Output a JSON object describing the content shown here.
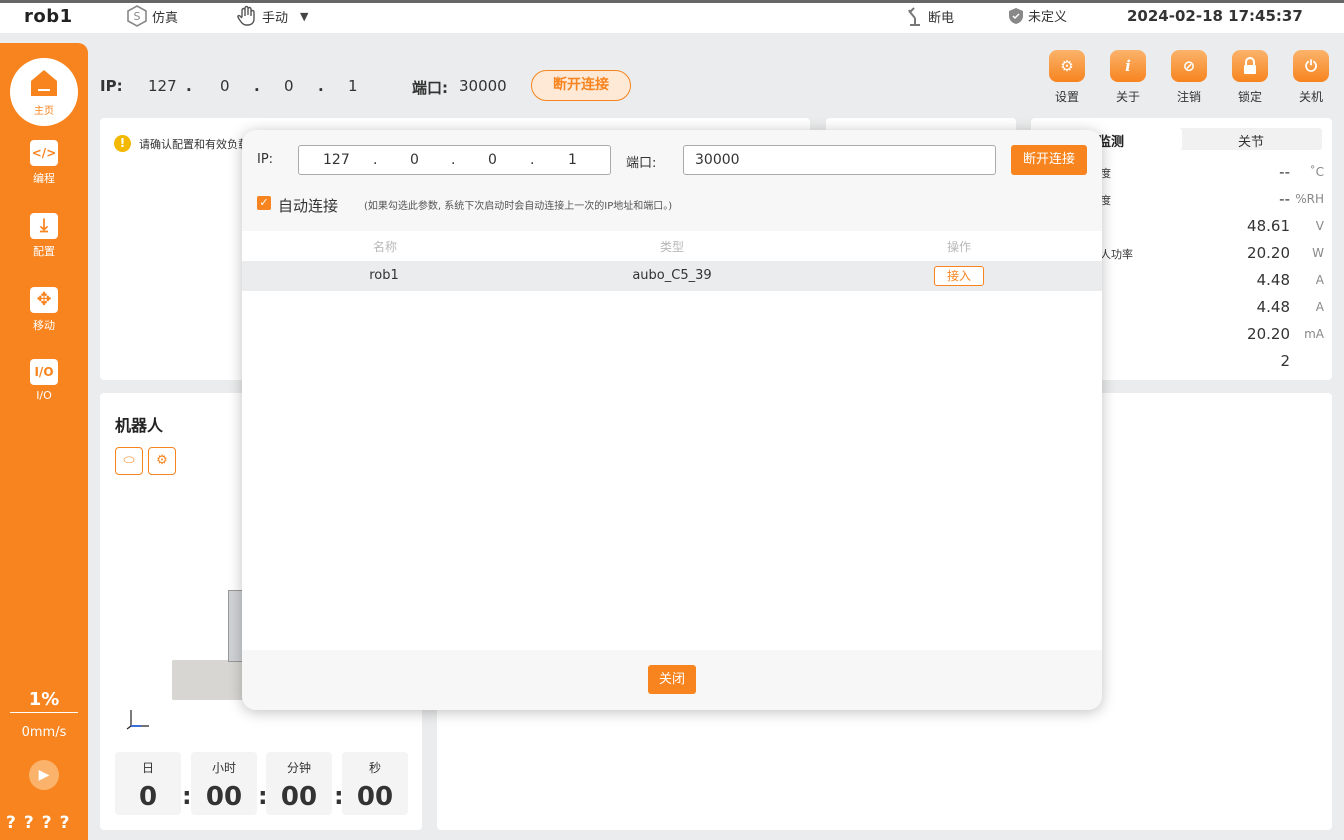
{
  "topbar": {
    "robot_name": "rob1",
    "sim_label": "仿真",
    "mode_label": "手动",
    "power_label": "断电",
    "safety_label": "未定义",
    "datetime": "2024-02-18 17:45:37"
  },
  "sidebar": {
    "home_label": "主页",
    "items": [
      {
        "label": "编程",
        "glyph": "</>"
      },
      {
        "label": "配置",
        "glyph": "⤓"
      },
      {
        "label": "移动",
        "glyph": "✥"
      },
      {
        "label": "I/O",
        "glyph": "I/O"
      }
    ],
    "speed_percent": "1%",
    "speed_mm": "0mm/s",
    "question_marks": "????"
  },
  "connection": {
    "ip_label": "IP:",
    "ip": [
      "127",
      ".",
      "0",
      ".",
      "0",
      ".",
      "1"
    ],
    "port_label": "端口:",
    "port": "30000",
    "disconnect_label": "断开连接"
  },
  "toolbar": [
    {
      "label": "设置",
      "icon": "gear-icon",
      "glyph": "⚙"
    },
    {
      "label": "关于",
      "icon": "info-icon",
      "glyph": "i"
    },
    {
      "label": "注销",
      "icon": "logout-icon",
      "glyph": "⊘"
    },
    {
      "label": "锁定",
      "icon": "lock-icon",
      "glyph": "🔒"
    },
    {
      "label": "关机",
      "icon": "power-icon",
      "glyph": "⏻"
    }
  ],
  "warning": {
    "text": "请确认配置和有效负载"
  },
  "monitor": {
    "tab_a": "监测",
    "tab_b": "关节",
    "rows": [
      {
        "label": "度",
        "value": "--",
        "unit": "˚C"
      },
      {
        "label": "度",
        "value": "--",
        "unit": "%RH"
      },
      {
        "label": "",
        "value": "48.61",
        "unit": "V"
      },
      {
        "label": "人功率",
        "value": "20.20",
        "unit": "W"
      },
      {
        "label": "",
        "value": "4.48",
        "unit": "A"
      },
      {
        "label": "",
        "value": "4.48",
        "unit": "A"
      },
      {
        "label": "",
        "value": "20.20",
        "unit": "mA"
      },
      {
        "label": "",
        "value": "2",
        "unit": ""
      }
    ]
  },
  "robot_panel": {
    "title": "机器人",
    "timer": [
      {
        "label": "日",
        "value": "0"
      },
      {
        "label": "小时",
        "value": "00"
      },
      {
        "label": "分钟",
        "value": "00"
      },
      {
        "label": "秒",
        "value": "00"
      }
    ],
    "colon": ":"
  },
  "modal": {
    "ip_label": "IP:",
    "ip_segments": [
      "127",
      "0",
      "0",
      "1"
    ],
    "dot": ".",
    "port_label": "端口:",
    "port_value": "30000",
    "disconnect_label": "断开连接",
    "auto_connect_checked": true,
    "check_glyph": "✓",
    "auto_connect_label": "自动连接",
    "auto_connect_note": "(如果勾选此参数, 系统下次启动时会自动连接上一次的IP地址和端口。)",
    "table": {
      "headers": [
        "名称",
        "类型",
        "操作"
      ],
      "rows": [
        {
          "name": "rob1",
          "type": "aubo_C5_39",
          "action": "接入"
        }
      ]
    },
    "close_label": "关闭"
  }
}
